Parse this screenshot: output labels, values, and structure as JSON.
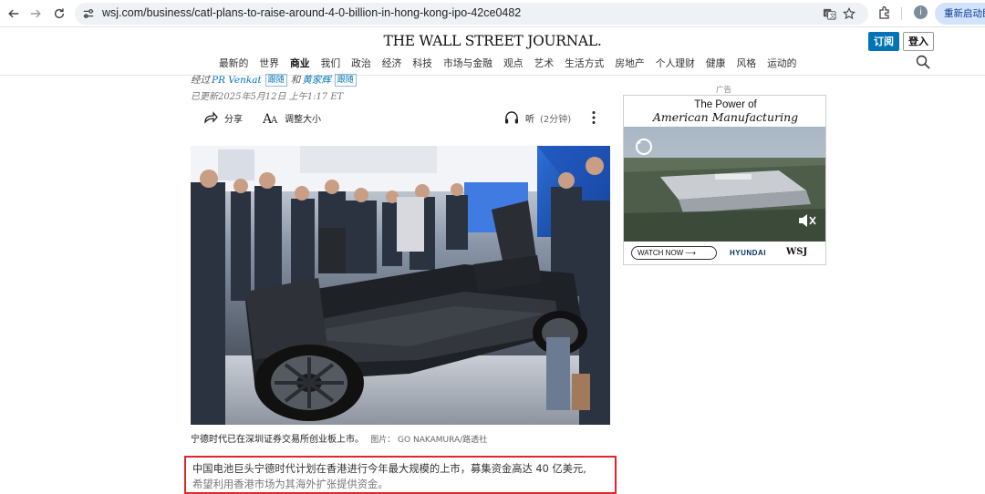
{
  "browser": {
    "url": "wsj.com/business/catl-plans-to-raise-around-4-0-billion-in-hong-kong-ipo-42ce0482",
    "restart_label": "重新启动即",
    "profile_initial": "i"
  },
  "site": {
    "logo": "THE WALL STREET JOURNAL.",
    "subscribe_label": "订阅",
    "login_label": "登入",
    "nav": [
      "最新的",
      "世界",
      "商业",
      "我们",
      "政治",
      "经济",
      "科技",
      "市场与金融",
      "观点",
      "艺术",
      "生活方式",
      "房地产",
      "个人理财",
      "健康",
      "风格",
      "运动的"
    ],
    "active_nav": "商业"
  },
  "article": {
    "byline_prefix": "经过",
    "author1": "PR Venkat",
    "follow_label": "跟随",
    "byline_and": "和",
    "author2": "黄家辉",
    "updated": "已更新2025年5月12日 上午1:17 ET",
    "share_label": "分享",
    "resize_label": "调整大小",
    "listen_label": "听",
    "listen_duration": "(2分钟)",
    "caption": "宁德时代已在深圳证券交易所创业板上市。",
    "credit": "图片：  GO NAKAMURA/路透社",
    "lede_line1": "中国电池巨头宁德时代计划在香港进行今年最大规模的上市，募集资金高达 40 亿美元,",
    "lede_line2": "希望利用香港市场为其海外扩张提供资金。"
  },
  "ad": {
    "label": "广告",
    "title_line1": "The Power of",
    "title_line2": "American Manufacturing",
    "watch_label": "WATCH NOW ⟶",
    "brand": "HYUNDAI",
    "partner": "WSJ"
  },
  "colors": {
    "accent": "#0274b6",
    "highlight_border": "#e0262a"
  }
}
